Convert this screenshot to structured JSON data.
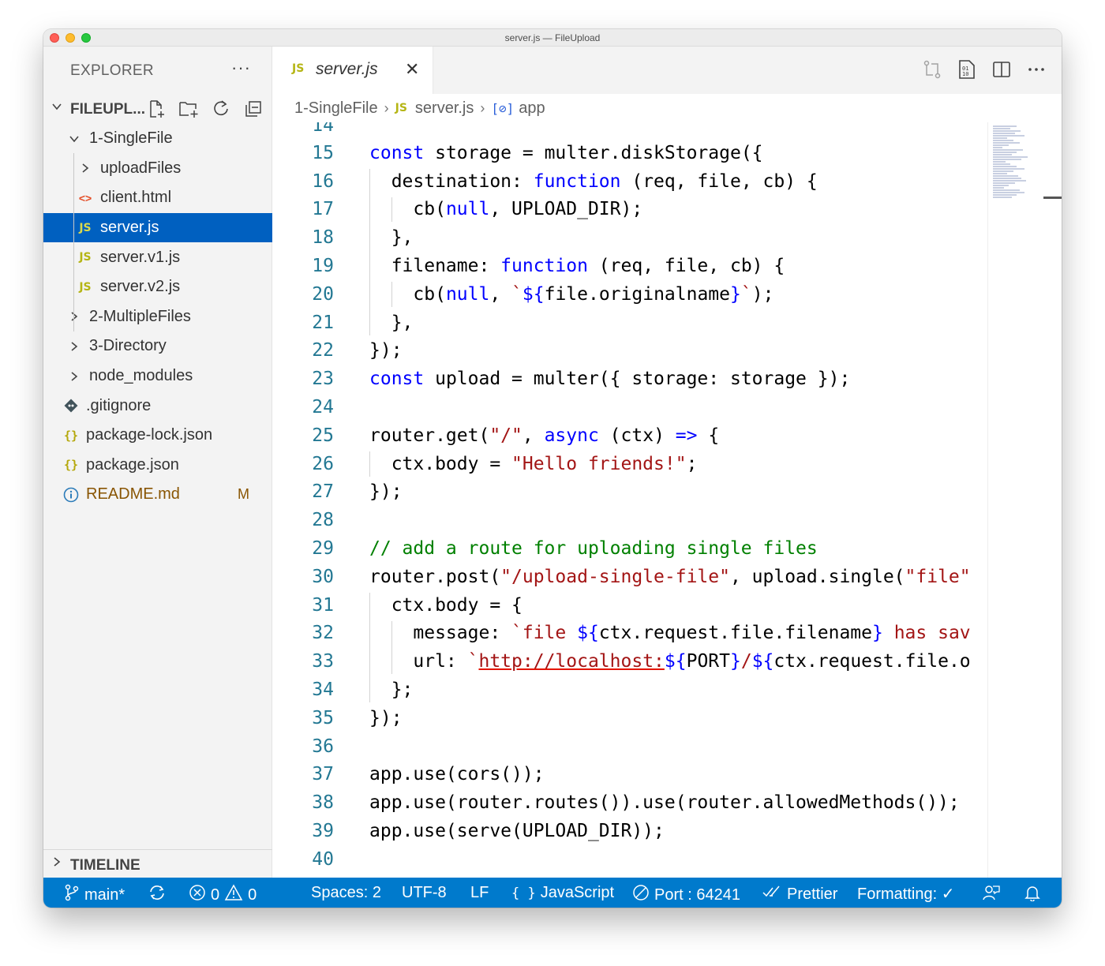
{
  "window": {
    "title": "server.js — FileUpload"
  },
  "sidebar": {
    "title": "EXPLORER",
    "more": "···",
    "root": "FILEUPL...",
    "items": [
      {
        "label": "1-SingleFile",
        "kind": "folder-open"
      },
      {
        "label": "uploadFiles",
        "kind": "folder"
      },
      {
        "label": "client.html",
        "kind": "html",
        "icon": "<>"
      },
      {
        "label": "server.js",
        "kind": "js",
        "icon": "JS",
        "selected": true
      },
      {
        "label": "server.v1.js",
        "kind": "js",
        "icon": "JS"
      },
      {
        "label": "server.v2.js",
        "kind": "js",
        "icon": "JS"
      },
      {
        "label": "2-MultipleFiles",
        "kind": "folder"
      },
      {
        "label": "3-Directory",
        "kind": "folder"
      },
      {
        "label": "node_modules",
        "kind": "folder"
      },
      {
        "label": ".gitignore",
        "kind": "git"
      },
      {
        "label": "package-lock.json",
        "kind": "json",
        "icon": "{}"
      },
      {
        "label": "package.json",
        "kind": "json",
        "icon": "{}"
      },
      {
        "label": "README.md",
        "kind": "info",
        "git_status": "M"
      }
    ],
    "timeline": "TIMELINE"
  },
  "tab": {
    "icon": "JS",
    "label": "server.js",
    "close": "✕"
  },
  "breadcrumb": {
    "folder": "1-SingleFile",
    "file_icon": "JS",
    "file": "server.js",
    "symbol_icon": "[⊘]",
    "symbol": "app"
  },
  "code": {
    "partial_line_number": "14",
    "lines": [
      {
        "n": "15",
        "t": [
          [
            "kw",
            "const"
          ],
          [
            "plain",
            " storage = multer.diskStorage({"
          ]
        ]
      },
      {
        "n": "16",
        "t": [
          [
            "plain",
            "  destination: "
          ],
          [
            "kw",
            "function"
          ],
          [
            "plain",
            " (req, file, cb) {"
          ]
        ]
      },
      {
        "n": "17",
        "t": [
          [
            "plain",
            "    cb("
          ],
          [
            "kw",
            "null"
          ],
          [
            "plain",
            ", UPLOAD_DIR);"
          ]
        ]
      },
      {
        "n": "18",
        "t": [
          [
            "plain",
            "  },"
          ]
        ]
      },
      {
        "n": "19",
        "t": [
          [
            "plain",
            "  filename: "
          ],
          [
            "kw",
            "function"
          ],
          [
            "plain",
            " (req, file, cb) {"
          ]
        ]
      },
      {
        "n": "20",
        "t": [
          [
            "plain",
            "    cb("
          ],
          [
            "kw",
            "null"
          ],
          [
            "plain",
            ", "
          ],
          [
            "str",
            "`"
          ],
          [
            "kw",
            "${"
          ],
          [
            "plain",
            "file.originalname"
          ],
          [
            "kw",
            "}"
          ],
          [
            "str",
            "`"
          ],
          [
            "plain",
            ");"
          ]
        ]
      },
      {
        "n": "21",
        "t": [
          [
            "plain",
            "  },"
          ]
        ]
      },
      {
        "n": "22",
        "t": [
          [
            "plain",
            "});"
          ]
        ]
      },
      {
        "n": "23",
        "t": [
          [
            "kw",
            "const"
          ],
          [
            "plain",
            " upload = multer({ storage: storage });"
          ]
        ]
      },
      {
        "n": "24",
        "t": []
      },
      {
        "n": "25",
        "t": [
          [
            "plain",
            "router.get("
          ],
          [
            "str",
            "\"/\""
          ],
          [
            "plain",
            ", "
          ],
          [
            "kw",
            "async"
          ],
          [
            "plain",
            " (ctx) "
          ],
          [
            "kw",
            "=>"
          ],
          [
            "plain",
            " {"
          ]
        ]
      },
      {
        "n": "26",
        "t": [
          [
            "plain",
            "  ctx.body = "
          ],
          [
            "str",
            "\"Hello friends!\""
          ],
          [
            "plain",
            ";"
          ]
        ]
      },
      {
        "n": "27",
        "t": [
          [
            "plain",
            "});"
          ]
        ]
      },
      {
        "n": "28",
        "t": []
      },
      {
        "n": "29",
        "t": [
          [
            "com",
            "// add a route for uploading single files"
          ]
        ]
      },
      {
        "n": "30",
        "t": [
          [
            "plain",
            "router.post("
          ],
          [
            "str",
            "\"/upload-single-file\""
          ],
          [
            "plain",
            ", upload.single("
          ],
          [
            "str",
            "\"file\""
          ]
        ]
      },
      {
        "n": "31",
        "t": [
          [
            "plain",
            "  ctx.body = {"
          ]
        ]
      },
      {
        "n": "32",
        "t": [
          [
            "plain",
            "    message: "
          ],
          [
            "str",
            "`file "
          ],
          [
            "kw",
            "${"
          ],
          [
            "plain",
            "ctx.request.file.filename"
          ],
          [
            "kw",
            "}"
          ],
          [
            "str",
            " has sav"
          ]
        ]
      },
      {
        "n": "33",
        "t": [
          [
            "plain",
            "    url: "
          ],
          [
            "str",
            "`"
          ],
          [
            "url",
            "http://localhost:"
          ],
          [
            "kw",
            "${"
          ],
          [
            "plain",
            "PORT"
          ],
          [
            "kw",
            "}"
          ],
          [
            "str",
            "/"
          ],
          [
            "kw",
            "${"
          ],
          [
            "plain",
            "ctx.request.file.o"
          ]
        ]
      },
      {
        "n": "34",
        "t": [
          [
            "plain",
            "  };"
          ]
        ]
      },
      {
        "n": "35",
        "t": [
          [
            "plain",
            "});"
          ]
        ]
      },
      {
        "n": "36",
        "t": []
      },
      {
        "n": "37",
        "t": [
          [
            "plain",
            "app.use(cors());"
          ]
        ]
      },
      {
        "n": "38",
        "t": [
          [
            "plain",
            "app.use(router.routes()).use(router.allowedMethods());"
          ]
        ]
      },
      {
        "n": "39",
        "t": [
          [
            "plain",
            "app.use(serve(UPLOAD_DIR));"
          ]
        ]
      },
      {
        "n": "40",
        "t": []
      }
    ]
  },
  "statusbar": {
    "branch": "main*",
    "errors": "0",
    "warnings": "0",
    "spaces": "Spaces: 2",
    "encoding": "UTF-8",
    "eol": "LF",
    "language_icon": "{ }",
    "language": "JavaScript",
    "port": "Port : 64241",
    "prettier": "Prettier",
    "formatting": "Formatting: ✓"
  },
  "colors": {
    "accent": "#007acc",
    "selection": "#0060c0",
    "keyword": "#0000ff",
    "string": "#a31515",
    "comment": "#008000",
    "line_number": "#237893"
  }
}
